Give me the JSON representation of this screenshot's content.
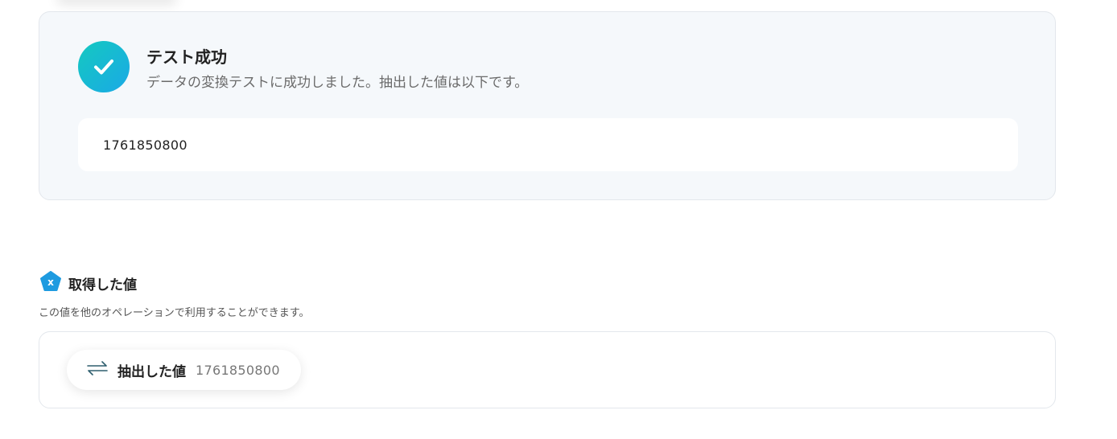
{
  "test_result": {
    "title": "テスト成功",
    "description": "データの変換テストに成功しました。抽出した値は以下です。",
    "value": "1761850800",
    "icon": "check-circle-icon",
    "accent_gradient": [
      "#14c9c0",
      "#1aa9e6"
    ]
  },
  "retrieved": {
    "title": "取得した値",
    "description": "この値を他のオペレーションで利用することができます。",
    "icon": "variable-badge-icon",
    "icon_color": "#1e9be0",
    "items": [
      {
        "label": "抽出した値",
        "value": "1761850800",
        "icon": "swap-arrows-icon"
      }
    ]
  }
}
